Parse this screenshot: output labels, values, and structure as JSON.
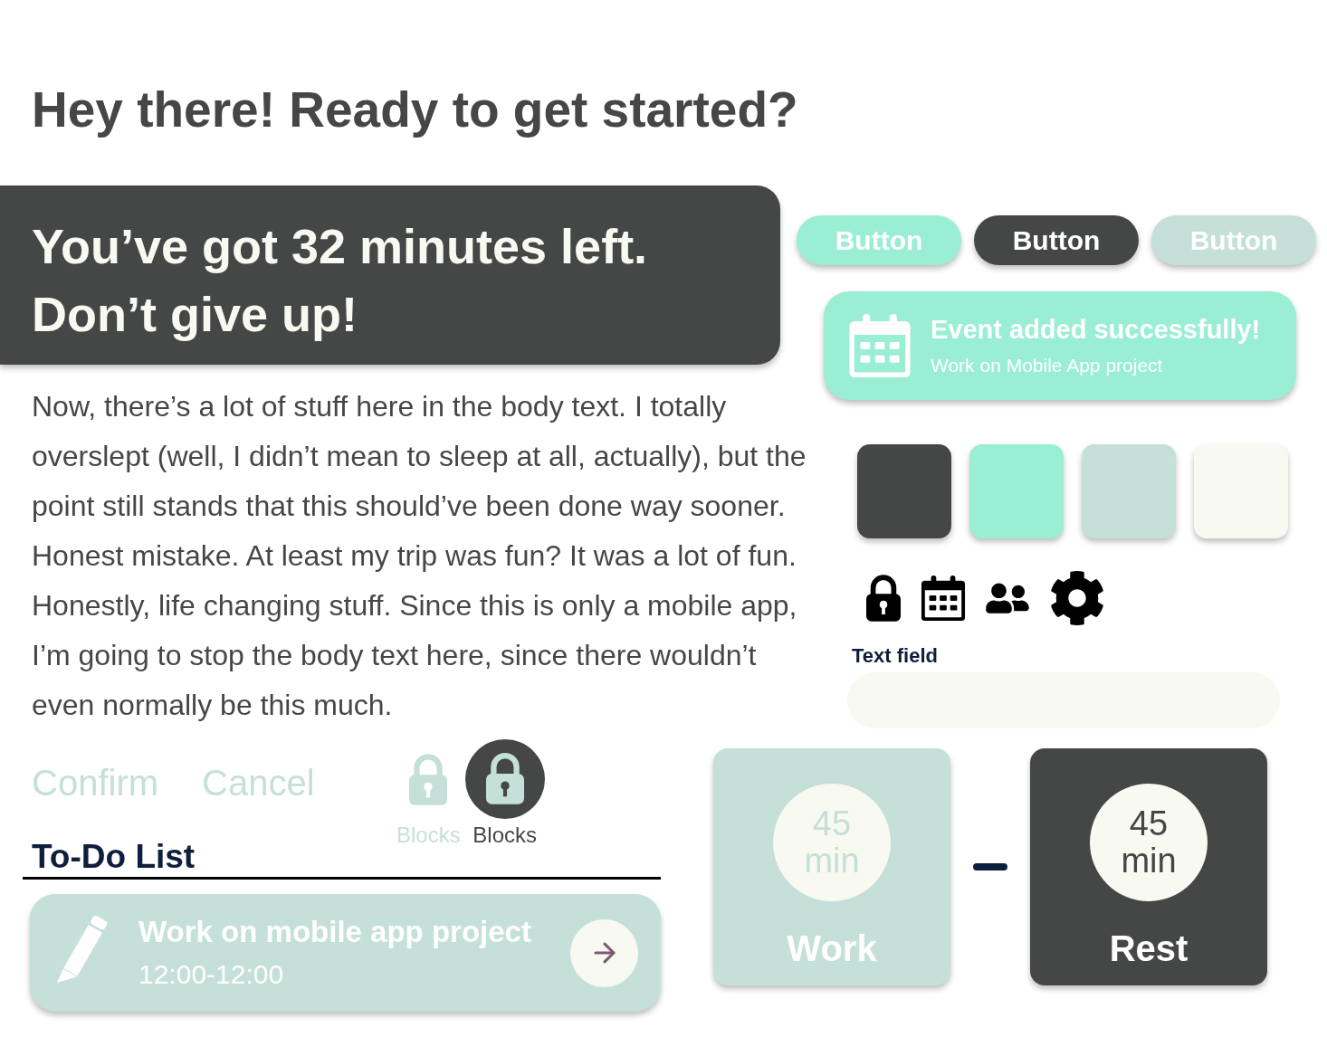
{
  "heading": "Hey there! Ready to get started?",
  "banner": {
    "lines": [
      "You’ve got 32 minutes left.",
      "Don’t give up!"
    ]
  },
  "body_text": "Now, there’s a lot of stuff here in the body text. I totally overslept (well, I didn’t mean to sleep at all, actually), but the point still stands that this should’ve been done way sooner. Honest mistake. At least my trip was fun? It was a lot of fun. Honestly, life changing stuff. Since this is only a mobile app, I’m going to stop the body text here, since there wouldn’t even normally be this much.",
  "buttons": [
    {
      "label": "Button",
      "color": "#9aeed4"
    },
    {
      "label": "Button",
      "color": "#454746"
    },
    {
      "label": "Button",
      "color": "#c5e0d8"
    }
  ],
  "toast": {
    "title": "Event added successfully!",
    "subtitle": "Work on Mobile App project"
  },
  "swatches": [
    {
      "color": "#454746"
    },
    {
      "color": "#9aeed4"
    },
    {
      "color": "#c5e0d8"
    },
    {
      "color": "#f8f9f1"
    }
  ],
  "text_field": {
    "label": "Text field"
  },
  "actions": [
    {
      "label": "Confirm"
    },
    {
      "label": "Cancel"
    }
  ],
  "blocks": [
    {
      "label": "Blocks",
      "selected": false
    },
    {
      "label": "Blocks",
      "selected": true
    }
  ],
  "todo": {
    "title": "To-Do List",
    "items": [
      {
        "title": "Work on mobile app project",
        "time": "12:00-12:00"
      }
    ]
  },
  "timers": [
    {
      "value": "45",
      "unit": "min",
      "label": "Work",
      "selected": false
    },
    {
      "value": "45",
      "unit": "min",
      "label": "Rest",
      "selected": true
    }
  ]
}
